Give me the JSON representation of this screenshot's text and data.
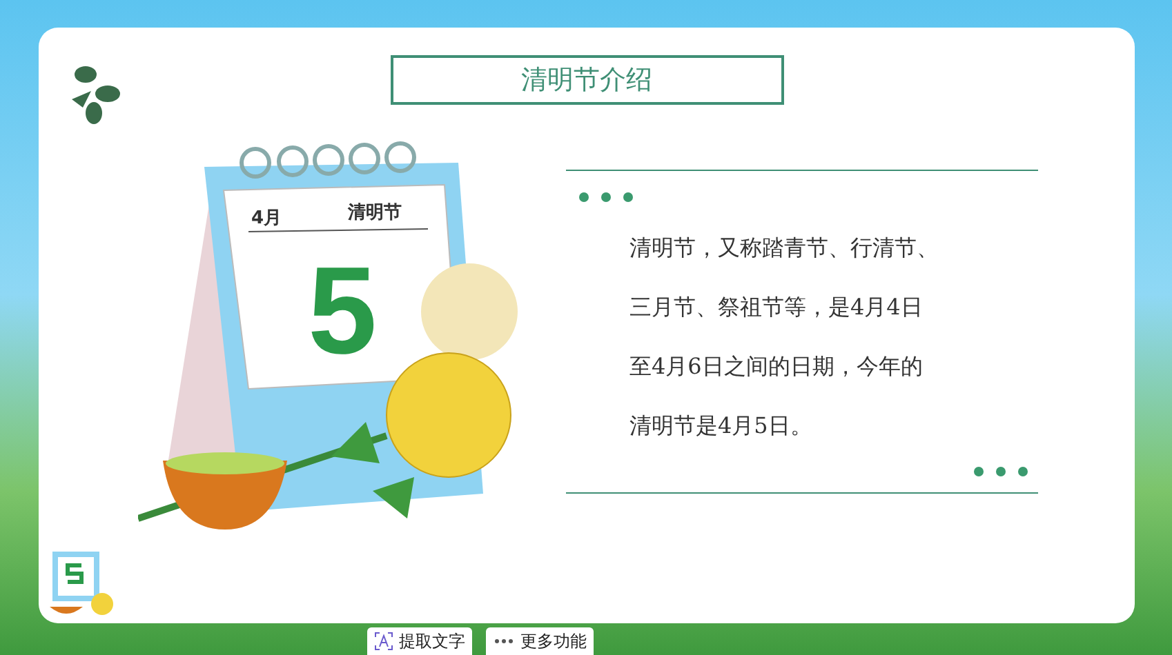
{
  "slide": {
    "title": "清明节介绍",
    "calendar": {
      "month": "4月",
      "festival": "清明节",
      "day": "5"
    },
    "intro": {
      "lines": [
        "清明节，又称踏青节、行清节、",
        "三月节、祭祖节等，是4月4日",
        "至4月6日之间的日期，今年的",
        "清明节是4月5日。"
      ]
    }
  },
  "toolbar": [
    {
      "kind": "extract",
      "label": "提取文字"
    },
    {
      "kind": "more",
      "label": "更多功能"
    }
  ]
}
